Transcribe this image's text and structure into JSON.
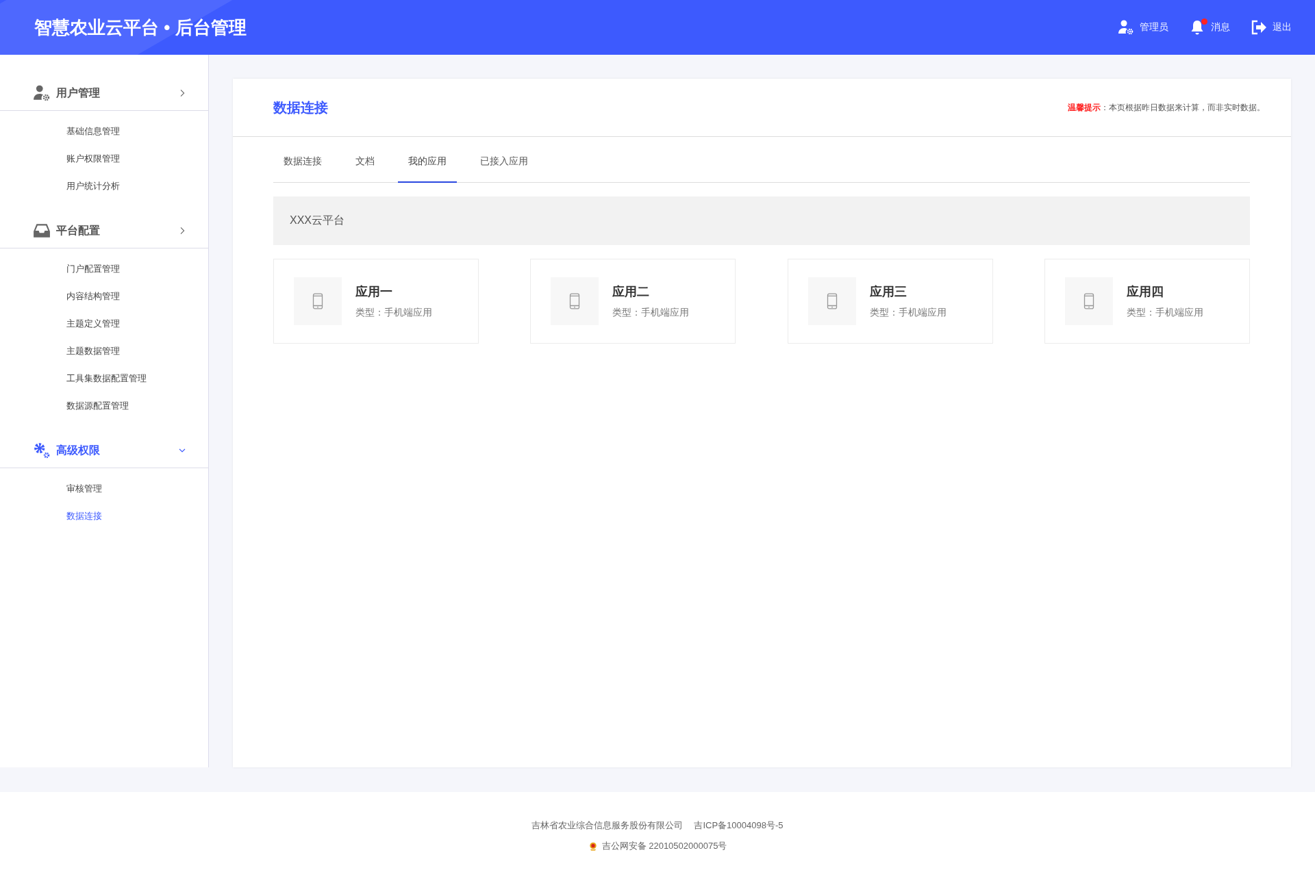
{
  "header": {
    "title": "智慧农业云平台 • 后台管理",
    "actions": [
      {
        "kind": "user",
        "label": "管理员",
        "unread": false
      },
      {
        "kind": "bell",
        "label": "消息",
        "unread": true
      },
      {
        "kind": "exit",
        "label": "退出",
        "unread": false
      }
    ]
  },
  "sidebar": {
    "groups": [
      {
        "kind": "user",
        "title": "用户管理",
        "active": false,
        "items": [
          {
            "label": "基础信息管理",
            "selected": false
          },
          {
            "label": "账户权限管理",
            "selected": false
          },
          {
            "label": "用户统计分析",
            "selected": false
          }
        ]
      },
      {
        "kind": "tray",
        "title": "平台配置",
        "active": false,
        "items": [
          {
            "label": "门户配置管理",
            "selected": false
          },
          {
            "label": "内容结构管理",
            "selected": false
          },
          {
            "label": "主题定义管理",
            "selected": false
          },
          {
            "label": "主题数据管理",
            "selected": false
          },
          {
            "label": "工具集数据配置管理",
            "selected": false
          },
          {
            "label": "数据源配置管理",
            "selected": false
          }
        ]
      },
      {
        "kind": "gears",
        "title": "高级权限",
        "active": true,
        "items": [
          {
            "label": "审核管理",
            "selected": false
          },
          {
            "label": "数据连接",
            "selected": true
          }
        ]
      }
    ]
  },
  "page": {
    "title": "数据连接",
    "notice": {
      "label": "温馨提示",
      "text": "：本页根据昨日数据来计算，而非实时数据。"
    },
    "tabs": [
      {
        "label": "数据连接",
        "selected": false
      },
      {
        "label": "文档",
        "selected": false
      },
      {
        "label": "我的应用",
        "selected": true
      },
      {
        "label": "已接入应用",
        "selected": false
      }
    ],
    "platform": "XXX云平台",
    "apps": [
      {
        "name": "应用一",
        "type": "类型：手机端应用"
      },
      {
        "name": "应用二",
        "type": "类型：手机端应用"
      },
      {
        "name": "应用三",
        "type": "类型：手机端应用"
      },
      {
        "name": "应用四",
        "type": "类型：手机端应用"
      }
    ]
  },
  "footer": {
    "company": "吉林省农业综合信息服务股份有限公司",
    "icp": "吉ICP备10004098号-5",
    "police": "吉公网安备 22010502000075号"
  }
}
